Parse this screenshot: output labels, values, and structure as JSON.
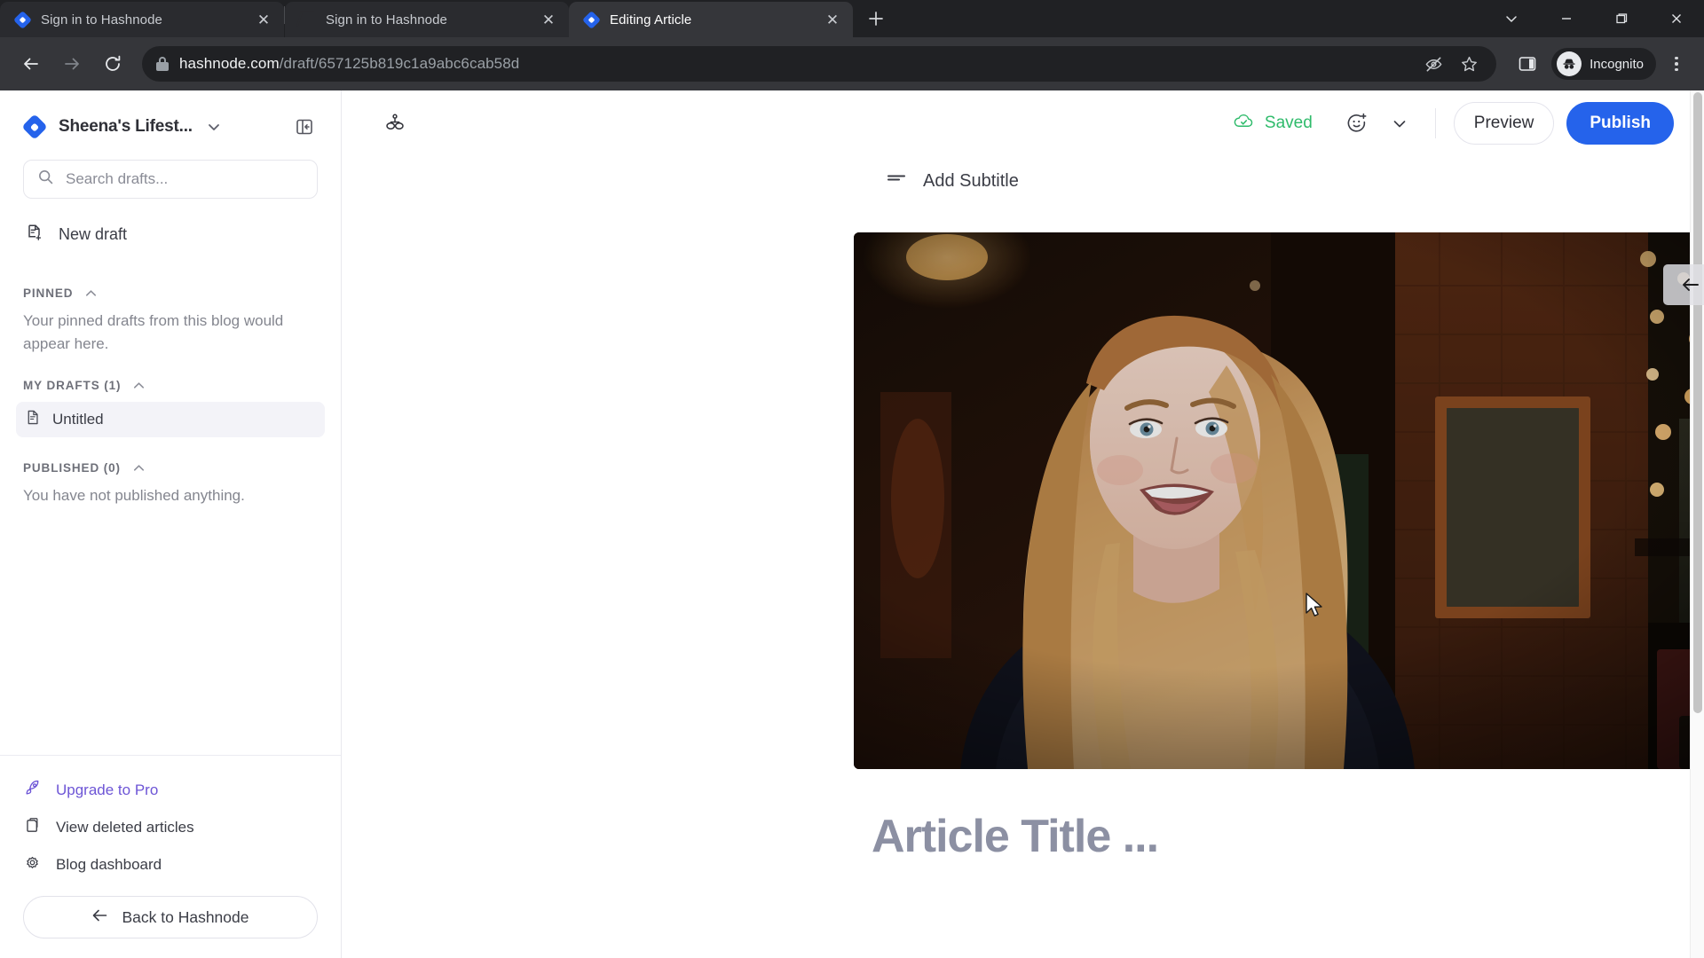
{
  "browser": {
    "tabs": [
      {
        "title": "Sign in to Hashnode",
        "favicon": "hashnode-icon",
        "active": false
      },
      {
        "title": "Sign in to Hashnode",
        "favicon": "globe-icon",
        "active": false
      },
      {
        "title": "Editing Article",
        "favicon": "hashnode-icon",
        "active": true
      }
    ],
    "new_tab_label": "+",
    "window_controls": [
      "chevron-down-icon",
      "minimize-icon",
      "maximize-icon",
      "close-icon"
    ],
    "nav": {
      "back": "back-arrow-icon",
      "forward": "forward-arrow-icon",
      "reload": "reload-icon"
    },
    "omnibox": {
      "lock": "lock-icon",
      "host": "hashnode.com",
      "path": "/draft/657125b819c1a9abc6cab58d",
      "icons": [
        "eye-off-icon",
        "bookmark-star-icon"
      ]
    },
    "toolbar_right": {
      "side_panel": "side-panel-icon",
      "profile_label": "Incognito",
      "profile_icon": "incognito-icon",
      "menu": "kebab-menu-icon"
    }
  },
  "sidebar": {
    "blog": {
      "name": "Sheena's Lifest...",
      "logo": "hashnode-logo-icon",
      "dropdown": "chevron-down-icon"
    },
    "collapse_icon": "collapse-sidebar-icon",
    "search": {
      "placeholder": "Search drafts...",
      "value": "",
      "icon": "search-icon"
    },
    "new_draft": {
      "label": "New draft",
      "icon": "new-document-icon"
    },
    "sections": [
      {
        "title": "PINNED",
        "empty_text": "Your pinned drafts from this blog would appear here.",
        "items": []
      },
      {
        "title": "MY DRAFTS (1)",
        "empty_text": "",
        "items": [
          {
            "label": "Untitled",
            "icon": "document-icon",
            "selected": true
          }
        ]
      },
      {
        "title": "PUBLISHED (0)",
        "empty_text": "You have not published anything.",
        "items": []
      }
    ],
    "links": [
      {
        "label": "Upgrade to Pro",
        "icon": "rocket-icon",
        "accent": true
      },
      {
        "label": "View deleted articles",
        "icon": "trash-copy-icon",
        "accent": false
      },
      {
        "label": "Blog dashboard",
        "icon": "gear-icon",
        "accent": false
      }
    ],
    "back_button": {
      "label": "Back to Hashnode",
      "icon": "arrow-left-icon"
    }
  },
  "editor": {
    "zen_icon": "focus-mode-icon",
    "status": {
      "label": "Saved",
      "icon": "cloud-check-icon",
      "color": "#2fbb6b"
    },
    "emoji_button": "add-emoji-icon",
    "dropdown_button": "chevron-down-icon",
    "preview_label": "Preview",
    "publish_label": "Publish",
    "publish_color": "#2563eb",
    "subtitle": {
      "label": "Add Subtitle",
      "icon": "subtitle-icon"
    },
    "cover": {
      "alt": "Smiling woman with long auburn hair in a dimly lit restaurant",
      "controls": [
        {
          "name": "move-image-button",
          "icon": "arrow-left-icon"
        },
        {
          "name": "resize-image-button",
          "icon": "vertical-resize-icon"
        },
        {
          "name": "remove-image-button",
          "icon": "close-icon"
        }
      ]
    },
    "title_placeholder": "Article Title ..."
  }
}
